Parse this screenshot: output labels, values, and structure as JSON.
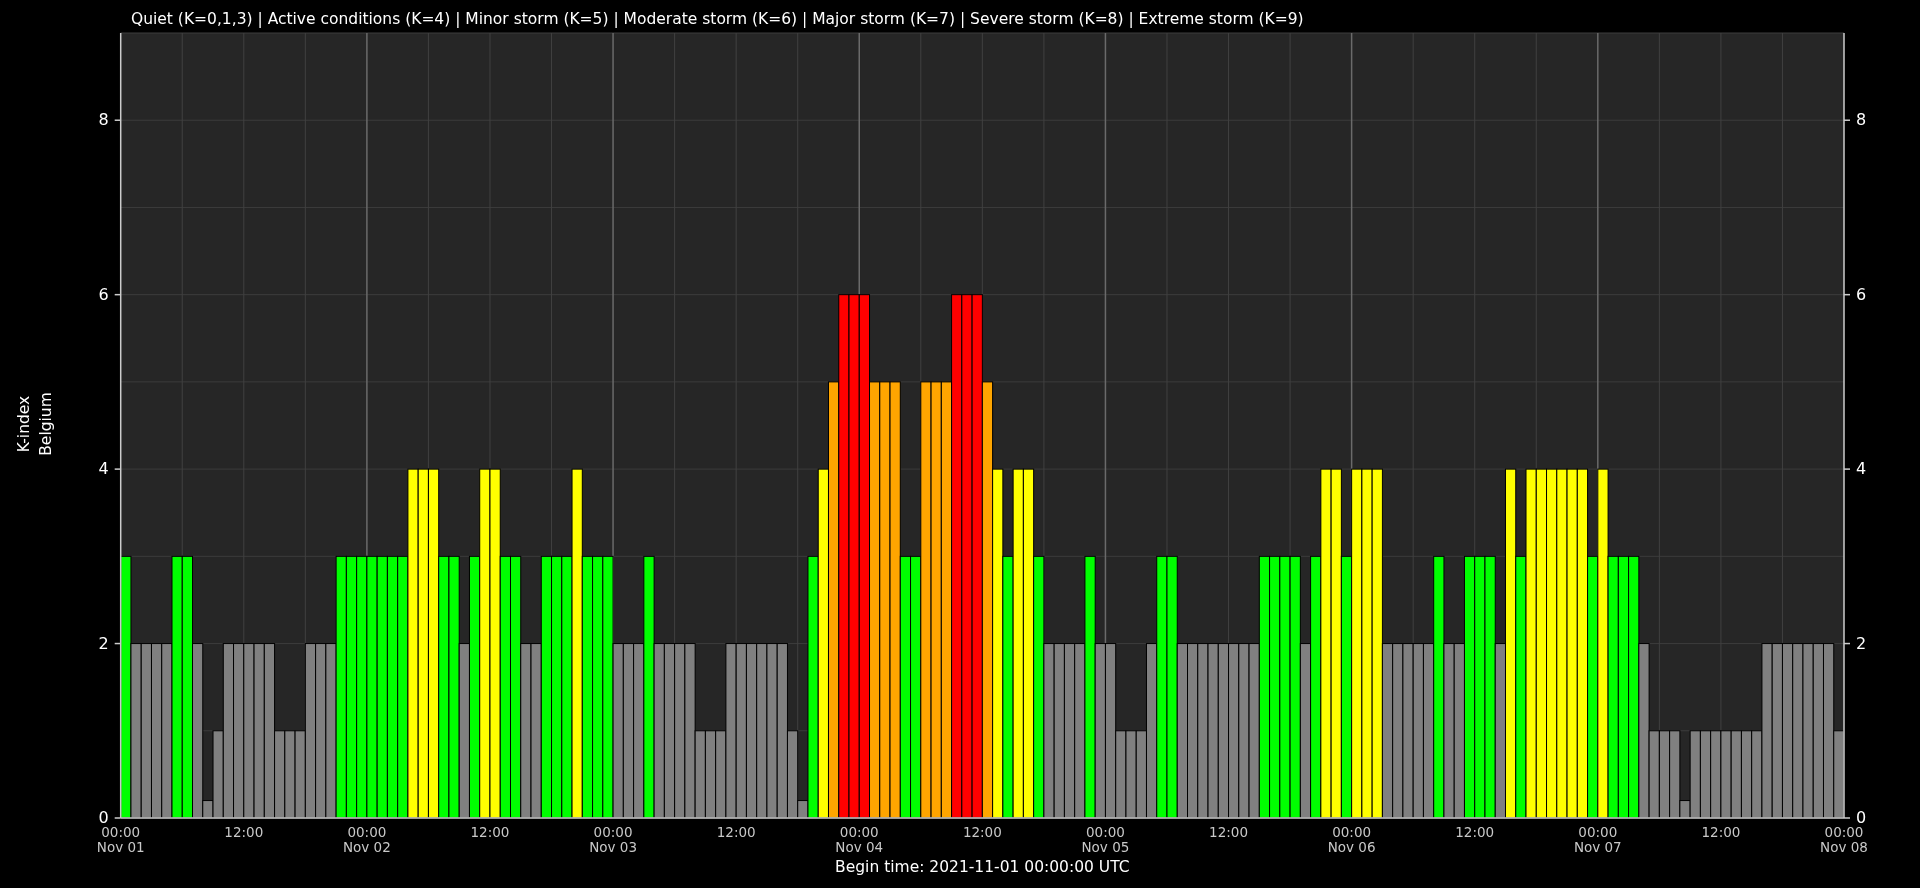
{
  "chart_data": {
    "type": "bar",
    "title": "Quiet (K=0,1,3) | Active conditions (K=4) | Minor storm (K=5) | Moderate storm (K=6) | Major storm (K=7) | Severe storm (K=8) | Extreme storm (K=9)",
    "xlabel": "Begin time: 2021-11-01 00:00:00 UTC",
    "ylabel": [
      "K-index",
      "Belgium"
    ],
    "ylim": [
      0,
      9
    ],
    "yticks": [
      0,
      2,
      4,
      6,
      8
    ],
    "grid": true,
    "categories": [
      "00:00\nNov 01",
      null,
      null,
      null,
      null,
      null,
      null,
      null,
      null,
      null,
      null,
      null,
      "12:00",
      null,
      null,
      null,
      null,
      null,
      null,
      null,
      null,
      null,
      null,
      null,
      "00:00\nNov 02",
      null,
      null,
      null,
      null,
      null,
      null,
      null,
      null,
      null,
      null,
      null,
      "12:00",
      null,
      null,
      null,
      null,
      null,
      null,
      null,
      null,
      null,
      null,
      null,
      "00:00\nNov 03",
      null,
      null,
      null,
      null,
      null,
      null,
      null,
      null,
      null,
      null,
      null,
      "12:00",
      null,
      null,
      null,
      null,
      null,
      null,
      null,
      null,
      null,
      null,
      null,
      "00:00\nNov 04",
      null,
      null,
      null,
      null,
      null,
      null,
      null,
      null,
      null,
      null,
      null,
      "12:00",
      null,
      null,
      null,
      null,
      null,
      null,
      null,
      null,
      null,
      null,
      null,
      "00:00\nNov 05",
      null,
      null,
      null,
      null,
      null,
      null,
      null,
      null,
      null,
      null,
      null,
      "12:00",
      null,
      null,
      null,
      null,
      null,
      null,
      null,
      null,
      null,
      null,
      null,
      "00:00\nNov 06",
      null,
      null,
      null,
      null,
      null,
      null,
      null,
      null,
      null,
      null,
      null,
      "12:00",
      null,
      null,
      null,
      null,
      null,
      null,
      null,
      null,
      null,
      null,
      null,
      "00:00\nNov 07",
      null,
      null,
      null,
      null,
      null,
      null,
      null,
      null,
      null,
      null,
      null,
      "12:00",
      null,
      null,
      null,
      null,
      null,
      null,
      null,
      null,
      null,
      null,
      null,
      "00:00\nNov 08"
    ],
    "series": [
      {
        "values": [
          3,
          2,
          2,
          2,
          2,
          3,
          3,
          2,
          0.2,
          1,
          2,
          2,
          2,
          2,
          2,
          1,
          1,
          1,
          2,
          2,
          2,
          3,
          3,
          3,
          3,
          3,
          3,
          3,
          4,
          4,
          4,
          3,
          3,
          2,
          3,
          4,
          4,
          3,
          3,
          2,
          2,
          3,
          3,
          3,
          4,
          3,
          3,
          3,
          2,
          2,
          2,
          3,
          2,
          2,
          2,
          2,
          1,
          1,
          1,
          2,
          2,
          2,
          2,
          2,
          2,
          1,
          0.2,
          3,
          4,
          5,
          6,
          6,
          6,
          5,
          5,
          5,
          3,
          3,
          5,
          5,
          5,
          6,
          6,
          6,
          5,
          4,
          3,
          4,
          4,
          3,
          2,
          2,
          2,
          2,
          3,
          2,
          2,
          1,
          1,
          1,
          2,
          3,
          3,
          2,
          2,
          2,
          2,
          2,
          2,
          2,
          2,
          3,
          3,
          3,
          3,
          2,
          3,
          4,
          4,
          3,
          4,
          4,
          4,
          2,
          2,
          2,
          2,
          2,
          3,
          2,
          2,
          3,
          3,
          3,
          2,
          4,
          3,
          4,
          4,
          4,
          4,
          4,
          4,
          3,
          4,
          3,
          3,
          3,
          2,
          1,
          1,
          1,
          0.2,
          1,
          1,
          1,
          1,
          1,
          1,
          1,
          2,
          2,
          2,
          2,
          2,
          2,
          2,
          1,
          null
        ]
      }
    ]
  },
  "k_colors": [
    {
      "color": "#808080"
    },
    {
      "color": "#808080"
    },
    {
      "color": "#808080"
    },
    {
      "color": "#00ff00"
    },
    {
      "color": "#ffff00"
    },
    {
      "color": "#ffa500"
    },
    {
      "color": "#ff0000"
    }
  ],
  "right_axis": {
    "ticks": [
      "8",
      "6",
      "4",
      "2",
      "0"
    ]
  }
}
